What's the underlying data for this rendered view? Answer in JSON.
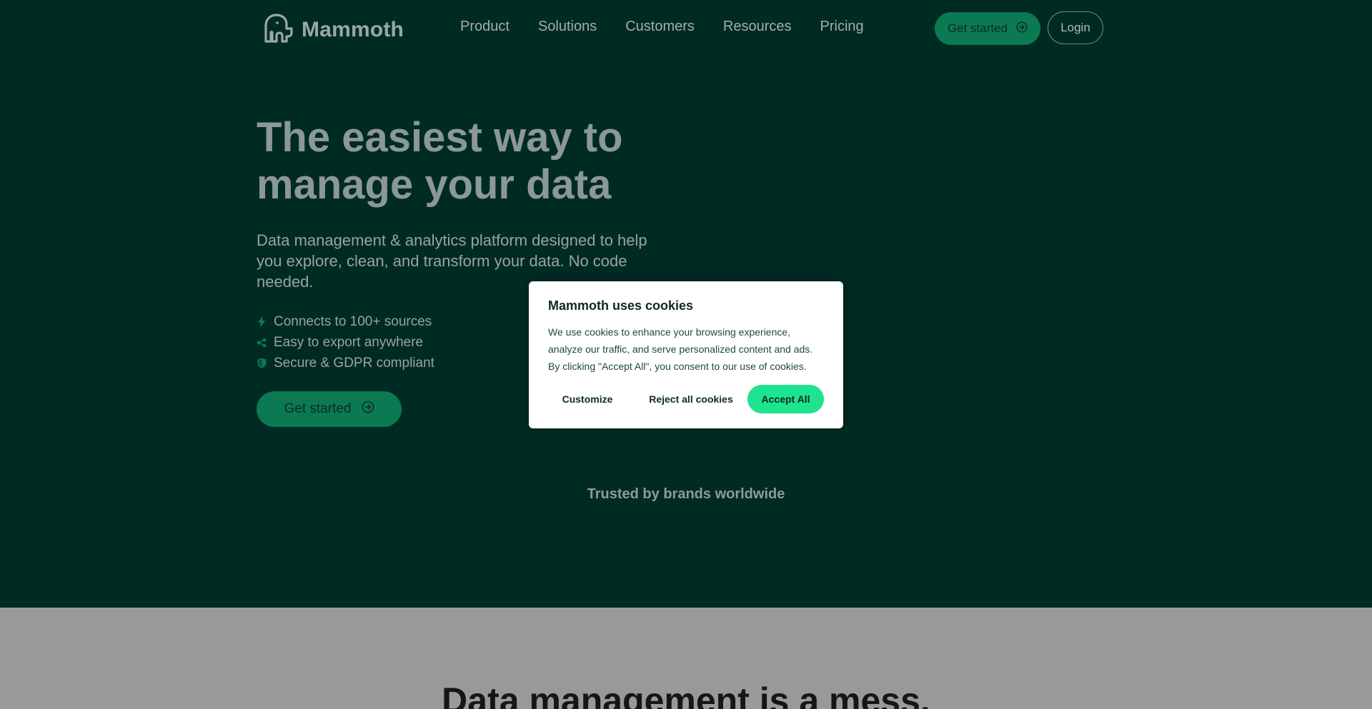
{
  "brand": {
    "name": "Mammoth",
    "accent": "#0b7a52",
    "accent_bright": "#1ee38f",
    "bg": "#002b22"
  },
  "header": {
    "nav": [
      {
        "label": "Product"
      },
      {
        "label": "Solutions"
      },
      {
        "label": "Customers"
      },
      {
        "label": "Resources"
      },
      {
        "label": "Pricing"
      }
    ],
    "cta_label": "Get started",
    "login_label": "Login"
  },
  "hero": {
    "headline": "The easiest way to manage your data",
    "subhead": "Data management & analytics platform designed to help you explore, clean, and transform your data. No code needed.",
    "features": [
      {
        "icon": "bolt-icon",
        "text": "Connects to 100+ sources"
      },
      {
        "icon": "share-icon",
        "text": "Easy to export anywhere"
      },
      {
        "icon": "shield-icon",
        "text": "Secure & GDPR compliant"
      }
    ],
    "cta_label": "Get started"
  },
  "trusted": {
    "text": "Trusted by brands worldwide"
  },
  "section2": {
    "title": "Data management is a mess."
  },
  "cookie": {
    "title": "Mammoth uses cookies",
    "body": "We use cookies to enhance your browsing experience, analyze our traffic, and serve personalized content and ads. By clicking \"Accept All\", you consent to our use of cookies.",
    "customize_label": "Customize",
    "reject_label": "Reject all cookies",
    "accept_label": "Accept All"
  }
}
